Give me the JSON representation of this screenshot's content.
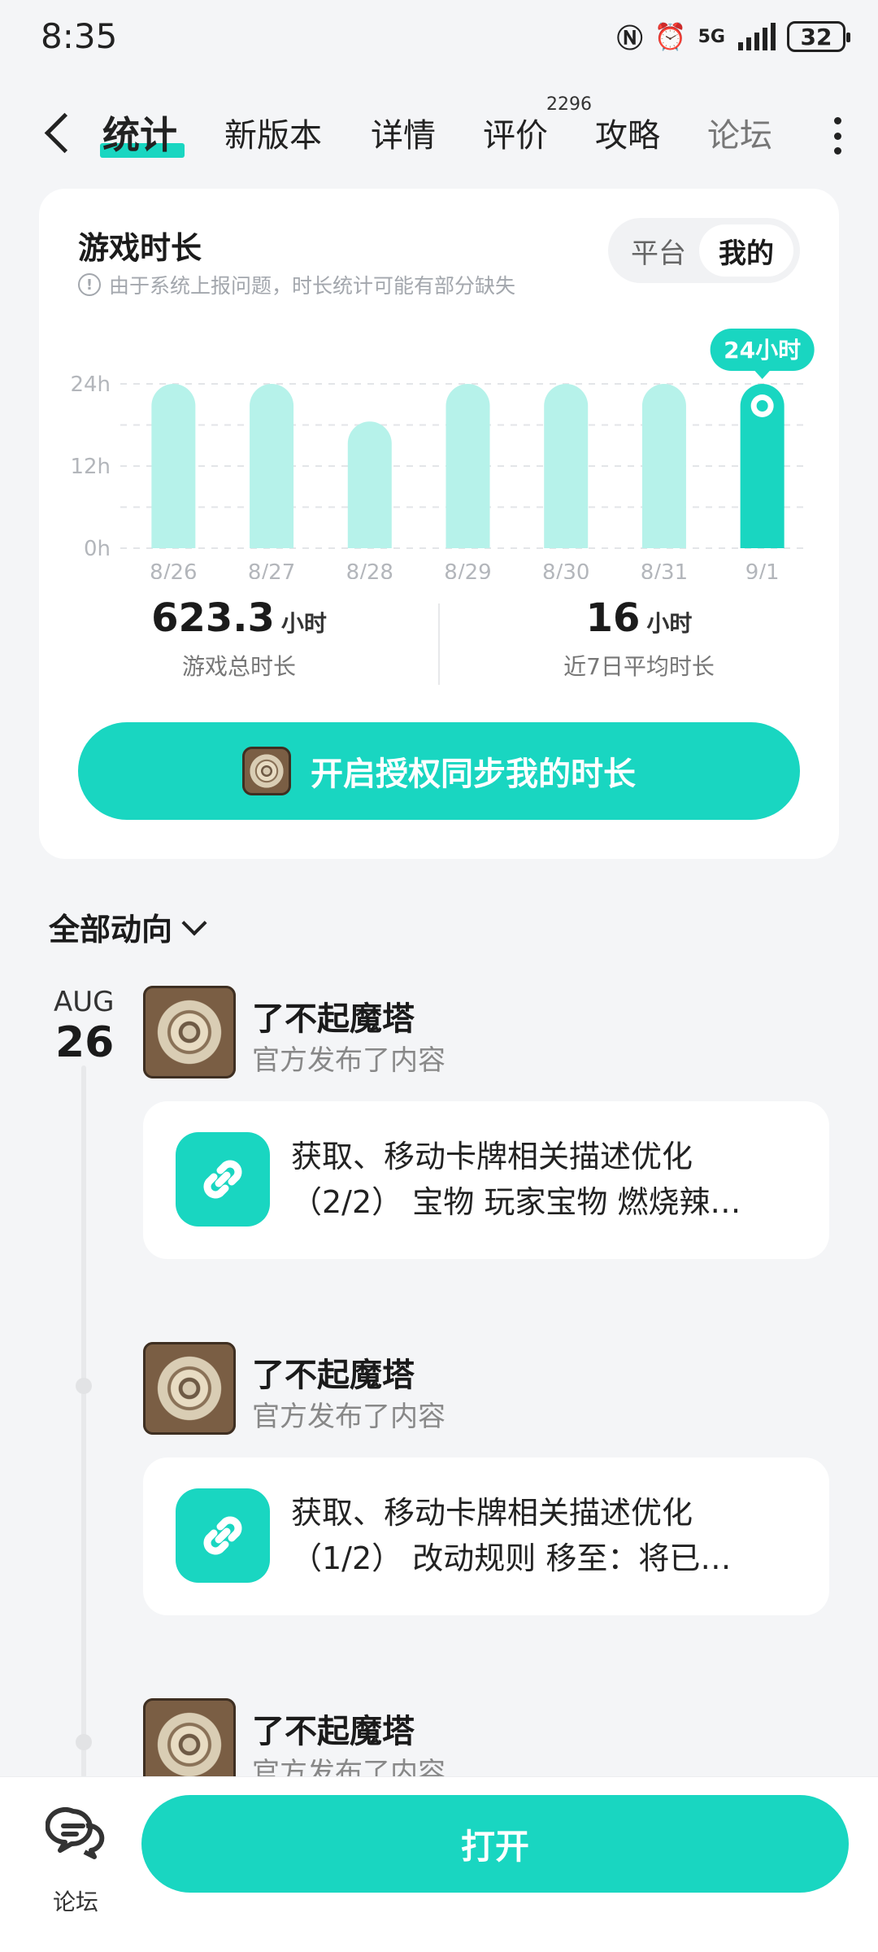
{
  "status_bar": {
    "time": "8:35",
    "network": "5G",
    "battery": "32"
  },
  "nav": {
    "tabs": [
      "统计",
      "新版本",
      "详情",
      "评价",
      "攻略",
      "论坛"
    ],
    "active_tab": "统计",
    "review_count": "2296"
  },
  "playtime_card": {
    "title": "游戏时长",
    "note": "由于系统上报问题，时长统计可能有部分缺失",
    "toggle": {
      "platform": "平台",
      "mine": "我的",
      "selected": "我的"
    },
    "highlight_label": "24小时",
    "total": {
      "value": "623.3",
      "unit": "小时",
      "label": "游戏总时长"
    },
    "average": {
      "value": "16",
      "unit": "小时",
      "label": "近7日平均时长"
    },
    "sync_button": "开启授权同步我的时长"
  },
  "chart_data": {
    "type": "bar",
    "categories": [
      "8/26",
      "8/27",
      "8/28",
      "8/29",
      "8/30",
      "8/31",
      "9/1"
    ],
    "values": [
      24,
      24,
      18.5,
      24,
      24,
      24,
      24
    ],
    "yticks": [
      "24h",
      "12h",
      "0h"
    ],
    "ylim": [
      0,
      24
    ],
    "highlight_index": 6,
    "colors": {
      "bar": "#b6f2ea",
      "highlight": "#19d6c1",
      "grid": "#e3e5e8",
      "tick": "#b3b6bb"
    },
    "grid": true
  },
  "feed": {
    "filter_label": "全部动向",
    "date": {
      "month": "AUG",
      "day": "26"
    },
    "posts": [
      {
        "game": "了不起魔塔",
        "action": "官方发布了内容",
        "text": "获取、移动卡牌相关描述优化（2/2） 宝物 玩家宝物 燃烧辣…"
      },
      {
        "game": "了不起魔塔",
        "action": "官方发布了内容",
        "text": "获取、移动卡牌相关描述优化（1/2） 改动规则 移至：将已…"
      },
      {
        "game": "了不起魔塔",
        "action": "官方发布了内容"
      }
    ]
  },
  "bottom_bar": {
    "forum_label": "论坛",
    "open_button": "打开"
  },
  "colors": {
    "accent": "#19d6c1",
    "accent_light": "#b6f2ea",
    "background": "#f4f5f7"
  },
  "icons": [
    "back-arrow-icon",
    "more-icon",
    "info-icon",
    "link-icon",
    "chevron-down-icon",
    "forum-chat-icon",
    "nfc-icon",
    "alarm-icon",
    "signal-icon",
    "battery-icon"
  ]
}
